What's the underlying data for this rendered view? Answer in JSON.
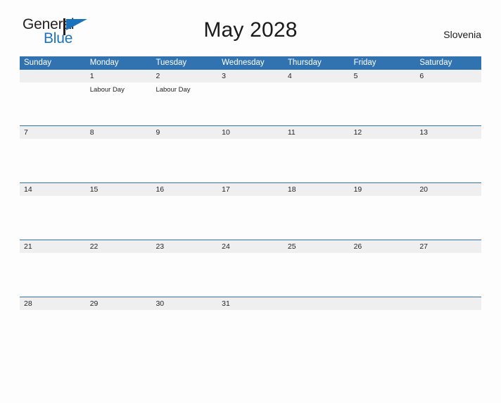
{
  "logo": {
    "word_one": "General",
    "word_two": "Blue",
    "flag_icon": "flag-triangle-icon",
    "brand_color": "#1b72bc"
  },
  "header": {
    "title": "May 2028",
    "locale": "Slovenia"
  },
  "colors": {
    "header_blue": "#3173b0",
    "daynum_band": "#efefef",
    "page_background": "#fdfdfd",
    "text": "#232323"
  },
  "calendar": {
    "weekday_headers": [
      "Sunday",
      "Monday",
      "Tuesday",
      "Wednesday",
      "Thursday",
      "Friday",
      "Saturday"
    ],
    "weeks": [
      {
        "days": [
          {
            "number": "",
            "events": []
          },
          {
            "number": "1",
            "events": [
              "Labour Day"
            ]
          },
          {
            "number": "2",
            "events": [
              "Labour Day"
            ]
          },
          {
            "number": "3",
            "events": []
          },
          {
            "number": "4",
            "events": []
          },
          {
            "number": "5",
            "events": []
          },
          {
            "number": "6",
            "events": []
          }
        ]
      },
      {
        "days": [
          {
            "number": "7",
            "events": []
          },
          {
            "number": "8",
            "events": []
          },
          {
            "number": "9",
            "events": []
          },
          {
            "number": "10",
            "events": []
          },
          {
            "number": "11",
            "events": []
          },
          {
            "number": "12",
            "events": []
          },
          {
            "number": "13",
            "events": []
          }
        ]
      },
      {
        "days": [
          {
            "number": "14",
            "events": []
          },
          {
            "number": "15",
            "events": []
          },
          {
            "number": "16",
            "events": []
          },
          {
            "number": "17",
            "events": []
          },
          {
            "number": "18",
            "events": []
          },
          {
            "number": "19",
            "events": []
          },
          {
            "number": "20",
            "events": []
          }
        ]
      },
      {
        "days": [
          {
            "number": "21",
            "events": []
          },
          {
            "number": "22",
            "events": []
          },
          {
            "number": "23",
            "events": []
          },
          {
            "number": "24",
            "events": []
          },
          {
            "number": "25",
            "events": []
          },
          {
            "number": "26",
            "events": []
          },
          {
            "number": "27",
            "events": []
          }
        ]
      },
      {
        "days": [
          {
            "number": "28",
            "events": []
          },
          {
            "number": "29",
            "events": []
          },
          {
            "number": "30",
            "events": []
          },
          {
            "number": "31",
            "events": []
          },
          {
            "number": "",
            "events": []
          },
          {
            "number": "",
            "events": []
          },
          {
            "number": "",
            "events": []
          }
        ]
      }
    ]
  }
}
